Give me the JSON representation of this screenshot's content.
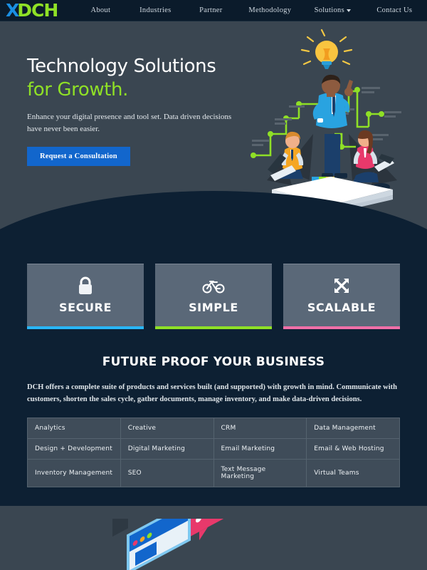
{
  "brand": {
    "logo_x": "X",
    "logo_text": "DCH"
  },
  "nav": {
    "items": [
      {
        "label": "About",
        "has_dropdown": false
      },
      {
        "label": "Industries",
        "has_dropdown": false
      },
      {
        "label": "Partner",
        "has_dropdown": false
      },
      {
        "label": "Methodology",
        "has_dropdown": false
      },
      {
        "label": "Solutions",
        "has_dropdown": true
      },
      {
        "label": "Contact Us",
        "has_dropdown": false
      }
    ]
  },
  "hero": {
    "heading_line1": "Technology Solutions",
    "heading_line2": "for Growth.",
    "subtext": "Enhance your digital presence and tool set. Data driven decisions have never been easier.",
    "cta_label": "Request a Consultation",
    "accent_color": "#8fe026",
    "cta_color": "#1266cc",
    "background_color": "#3a4651",
    "illustration": "team-with-lightbulb-and-growth-chart-illustration"
  },
  "features": {
    "cards": [
      {
        "label": "SECURE",
        "icon": "lock-icon",
        "bar_color": "#29b6f6"
      },
      {
        "label": "SIMPLE",
        "icon": "bicycle-icon",
        "bar_color": "#8fe026"
      },
      {
        "label": "SCALABLE",
        "icon": "expand-arrows-icon",
        "bar_color": "#f06fa8"
      }
    ]
  },
  "future_proof": {
    "title": "FUTURE PROOF YOUR BUSINESS",
    "body": "DCH offers a complete suite of products and services built (and supported) with growth in mind. Communicate with customers, shorten the sales cycle, gather documents, manage inventory, and make data-driven decisions.",
    "services_table": [
      [
        "Analytics",
        "Creative",
        "CRM",
        "Data Management"
      ],
      [
        "Design + Development",
        "Digital Marketing",
        "Email Marketing",
        "Email & Web Hosting"
      ],
      [
        "Inventory Management",
        "SEO",
        "Text Message Marketing",
        "Virtual Teams"
      ]
    ]
  },
  "bottom_section": {
    "illustration": "isometric-browser-window-with-chat-bubble-illustration",
    "background_color": "#3a4651"
  },
  "theme": {
    "dark_navy": "#0d2033",
    "nav_bg": "#0b1b2b",
    "slate": "#3a4651",
    "card_bg": "#5a6878"
  }
}
